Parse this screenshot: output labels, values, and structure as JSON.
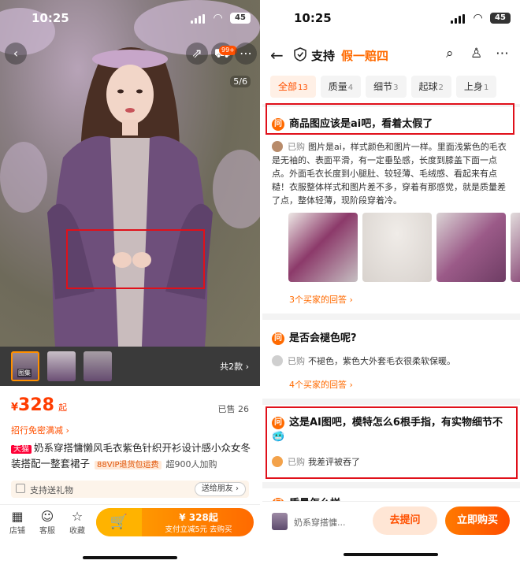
{
  "left": {
    "status": {
      "time": "10:25",
      "battery": "45"
    },
    "cart_badge": "99+",
    "image_index": "5/6",
    "thumb_tag": "图集",
    "variants_total": "共2款",
    "price": {
      "currency": "¥",
      "value": "328",
      "suffix": "起"
    },
    "sold": "已售 26",
    "promo": "招行免密满减",
    "title": {
      "tmall_tag": "天猫",
      "text": "奶系穿搭慵懒风毛衣紫色针织开衫设计感小众女冬装搭配一整套裙子",
      "vip_tag": "88VIP退货包运费",
      "buyers": "超900人加购"
    },
    "gift": {
      "label": "支持送礼物",
      "button": "送给朋友"
    },
    "nav": [
      {
        "label": "店铺",
        "icon": "store-icon"
      },
      {
        "label": "客服",
        "icon": "service-icon"
      },
      {
        "label": "收藏",
        "icon": "star-icon"
      }
    ],
    "buy_button": {
      "price_line": "¥ 328起",
      "sub_line": "支付立减5元 去购买"
    },
    "colors": {
      "accent": "#ff5000",
      "tmall": "#ff0036",
      "highlight_box": "#e0101a"
    }
  },
  "right": {
    "status": {
      "time": "10:25",
      "battery": "45"
    },
    "header": {
      "support": "支持",
      "guarantee": "假一赔四"
    },
    "tabs": [
      {
        "label": "全部",
        "count": "13",
        "active": true
      },
      {
        "label": "质量",
        "count": "4"
      },
      {
        "label": "细节",
        "count": "3"
      },
      {
        "label": "起球",
        "count": "2"
      },
      {
        "label": "上身",
        "count": "1"
      }
    ],
    "questions": [
      {
        "badge": "问",
        "question": "商品图应该是ai吧，看着太假了",
        "answer_tag": "已购",
        "answer": "图片是ai，样式颜色和图片一样。里面浅紫色的毛衣是无袖的、表面平滑，有一定垂坠感，长度到膝盖下面一点点。外面毛衣长度到小腿肚、较轻薄、毛绒感、看起来有点糙！衣服整体样式和图片差不多，穿着有那感觉，就是质量差了点，整体轻薄，现阶段穿着冷。",
        "more": "3个买家的回答"
      },
      {
        "badge": "问",
        "question": "是否会褪色呢?",
        "answer_tag": "已购",
        "answer": "不褪色，紫色大外套毛衣很柔软保暖。",
        "more": "4个买家的回答"
      },
      {
        "badge": "问",
        "question": "这是AI图吧，模特怎么6根手指，有实物细节不🥶",
        "answer_tag": "已购",
        "answer": "我差评被吞了"
      },
      {
        "badge": "问",
        "question": "质量怎么样"
      }
    ],
    "bottom": {
      "product_name": "奶系穿搭慵...",
      "ask": "去提问",
      "buy": "立即购买"
    },
    "colors": {
      "accent": "#ff6a00",
      "highlight_box": "#e0101a"
    }
  }
}
